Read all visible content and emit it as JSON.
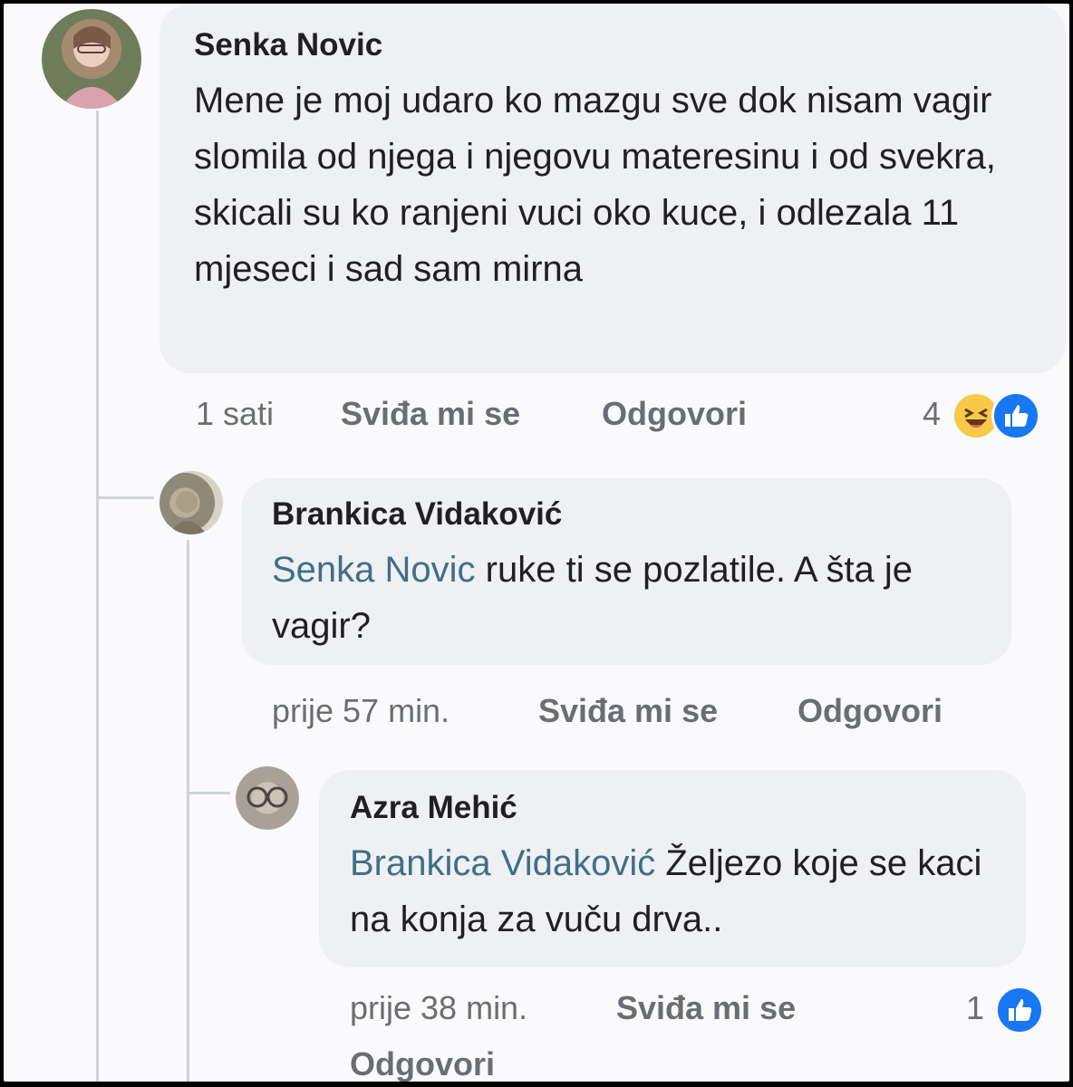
{
  "comments": [
    {
      "author": "Senka Novic",
      "text": "Mene je moj udaro ko mazgu sve dok nisam vagir slomila od njega i njegovu materesinu i od svekra, skicali su ko ranjeni vuci oko kuce, i odlezala 11 mjeseci i sad sam mirna",
      "time": "1 sati",
      "like_label": "Sviđa mi se",
      "reply_label": "Odgovori",
      "reaction_count": "4",
      "reactions": [
        "haha-icon",
        "like-icon"
      ]
    },
    {
      "author": "Brankica Vidaković",
      "mention": "Senka Novic",
      "text": " ruke ti se pozlatile. A šta je vagir?",
      "time": "prije 57 min.",
      "like_label": "Sviđa mi se",
      "reply_label": "Odgovori"
    },
    {
      "author": "Azra Mehić",
      "mention": "Brankica Vidaković",
      "text": " Željezo koje se kaci na konja za vuču drva..",
      "time": "prije 38 min.",
      "like_label": "Sviđa mi se",
      "reply_label": "Odgovori",
      "reaction_count": "1",
      "reactions": [
        "like-icon"
      ]
    }
  ],
  "colors": {
    "bubble": "#eff0f4",
    "mention": "#3f6f86",
    "like_blue": "#1877f2",
    "haha_yellow": "#f7c948"
  }
}
